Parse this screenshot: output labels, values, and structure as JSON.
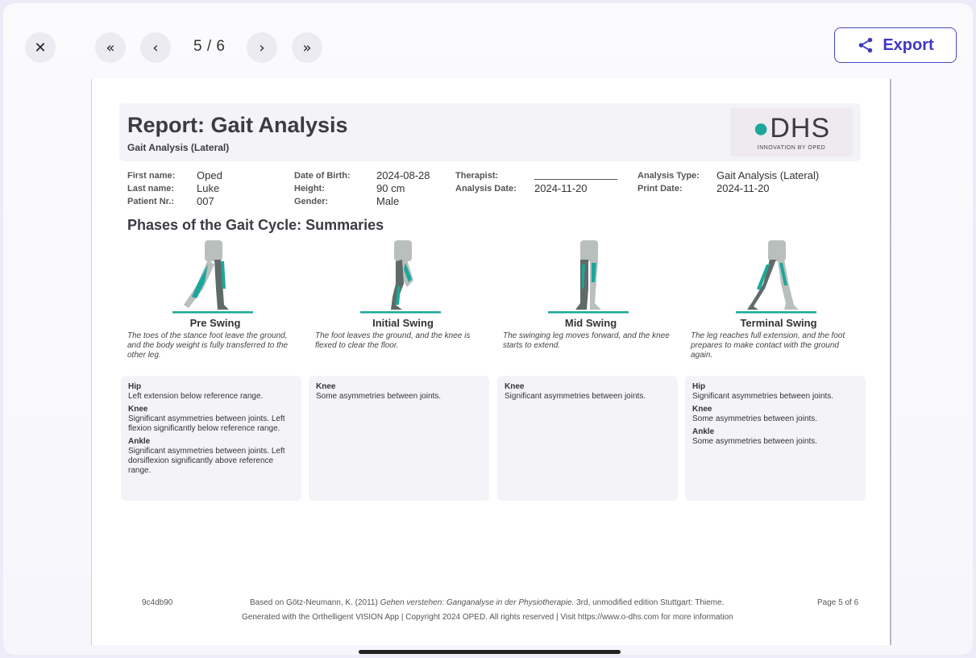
{
  "toolbar": {
    "close_icon": "close-icon",
    "first_icon": "first-page-icon",
    "prev_icon": "prev-page-icon",
    "page_indicator": "5 / 6",
    "next_icon": "next-page-icon",
    "last_icon": "last-page-icon",
    "export_label": "Export",
    "accent": "#3e37c2"
  },
  "report": {
    "title": "Report: Gait Analysis",
    "subtitle": "Gait Analysis (Lateral)",
    "logo_text": "DHS",
    "logo_tag": "INNOVATION BY OPED",
    "info": {
      "first_name_label": "First name:",
      "first_name": "Oped",
      "last_name_label": "Last name:",
      "last_name": "Luke",
      "patient_nr_label": "Patient Nr.:",
      "patient_nr": "007",
      "dob_label": "Date of Birth:",
      "dob": "2024-08-28",
      "height_label": "Height:",
      "height": "90 cm",
      "gender_label": "Gender:",
      "gender": "Male",
      "therapist_label": "Therapist:",
      "therapist": "",
      "analysis_date_label": "Analysis Date:",
      "analysis_date": "2024-11-20",
      "analysis_type_label": "Analysis Type:",
      "analysis_type": "Gait Analysis (Lateral)",
      "print_date_label": "Print Date:",
      "print_date": "2024-11-20"
    },
    "section_title": "Phases of the Gait Cycle: Summaries",
    "phases": [
      {
        "name": "Pre Swing",
        "desc": "The toes of the stance foot leave the ground, and the body weight is fully transferred to the other leg."
      },
      {
        "name": "Initial Swing",
        "desc": "The foot leaves the ground, and the knee is flexed to clear the floor."
      },
      {
        "name": "Mid Swing",
        "desc": "The swinging leg moves forward, and the knee starts to extend."
      },
      {
        "name": "Terminal Swing",
        "desc": "The leg reaches full extension, and the foot prepares to make contact with the ground again."
      }
    ],
    "cards": [
      [
        {
          "h": "Hip",
          "t": "Left extension below reference range."
        },
        {
          "h": "Knee",
          "t": "Significant asymmetries between joints. Left flexion significantly below reference range."
        },
        {
          "h": "Ankle",
          "t": "Significant asymmetries between joints. Left dorsiflexion significantly above reference range."
        }
      ],
      [
        {
          "h": "Knee",
          "t": "Some asymmetries between joints."
        }
      ],
      [
        {
          "h": "Knee",
          "t": "Significant asymmetries between joints."
        }
      ],
      [
        {
          "h": "Hip",
          "t": "Significant asymmetries between joints."
        },
        {
          "h": "Knee",
          "t": "Some asymmetries between joints."
        },
        {
          "h": "Ankle",
          "t": "Some asymmetries between joints."
        }
      ]
    ],
    "footer": {
      "id": "9c4db90",
      "ref_prefix": "Based on Götz-Neumann, K. (2011) ",
      "ref_italic": "Gehen verstehen: Ganganalyse in der Physiotherapie.",
      "ref_suffix": " 3rd, unmodified edition Stuttgart: Thieme.",
      "page": "Page 5 of 6",
      "generated": "Generated with the Orthelligent VISION App | Copyright 2024 OPED. All rights reserved | Visit https://www.o-dhs.com for more information"
    },
    "colors": {
      "teal": "#1ba89a",
      "leg_dark": "#5f6b68",
      "leg_light": "#b9bfbd"
    }
  }
}
